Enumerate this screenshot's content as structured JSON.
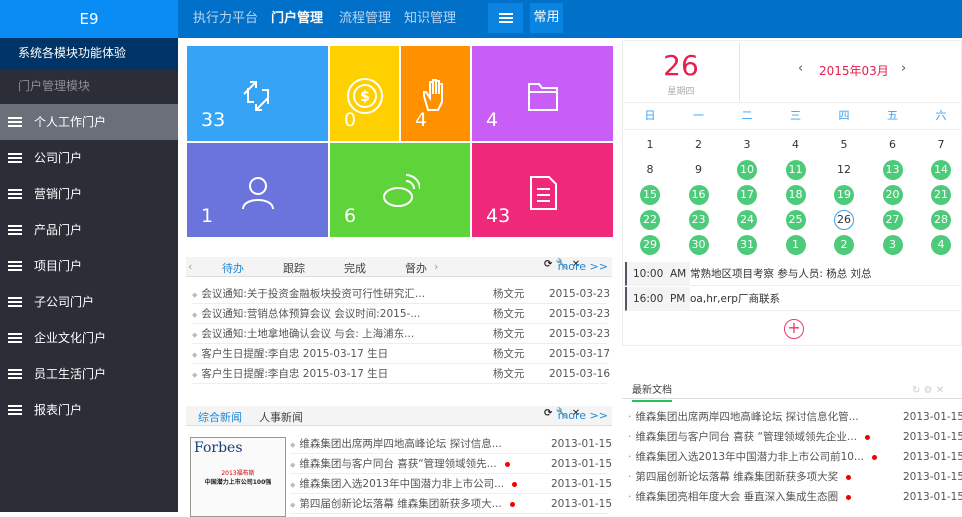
{
  "app": {
    "logo": "E9"
  },
  "topnav": {
    "items": [
      "执行力平台",
      "门户管理",
      "流程管理",
      "知识管理"
    ],
    "active": 1,
    "menu_icon": "hamburger-icon",
    "common_label": "常用"
  },
  "sidebar": {
    "title": "系统各模块功能体验",
    "subtitle": "门户管理模块",
    "items": [
      "个人工作门户",
      "公司门户",
      "营销门户",
      "产品门户",
      "项目门户",
      "子公司门户",
      "企业文化门户",
      "员工生活门户",
      "报表门户"
    ],
    "active": 0
  },
  "tiles": [
    {
      "icon": "sync-arrows-icon",
      "count": "33",
      "color": "#36a3f7"
    },
    {
      "icon": "dollar-coin-icon",
      "count": "0",
      "color": "#ffd000"
    },
    {
      "icon": "hand-icon",
      "count": "4",
      "color": "#ff9000"
    },
    {
      "icon": "folder-icon",
      "count": "4",
      "color": "#c95ef7"
    },
    {
      "icon": "user-icon",
      "count": "1",
      "color": "#6a74dc"
    },
    {
      "icon": "weibo-icon",
      "count": "6",
      "color": "#5ed43a"
    },
    {
      "icon": "document-icon",
      "count": "43",
      "color": "#f0287a"
    }
  ],
  "tasks": {
    "tabs": [
      "待办",
      "跟踪",
      "完成",
      "督办"
    ],
    "active": 0,
    "more": "more >>",
    "rows": [
      {
        "title": "会议通知:关于投资金融板块投资可行性研究汇...",
        "person": "杨文元",
        "date": "2015-03-23"
      },
      {
        "title": "会议通知:营销总体预算会议 会议时间:2015-...",
        "person": "杨文元",
        "date": "2015-03-23"
      },
      {
        "title": "会议通知:土地拿地确认会议 与会: 上海浦东...",
        "person": "杨文元",
        "date": "2015-03-23"
      },
      {
        "title": "客户生日提醒:李自忠 2015-03-17 生日",
        "person": "杨文元",
        "date": "2015-03-17"
      },
      {
        "title": "客户生日提醒:李自忠 2015-03-17 生日",
        "person": "杨文元",
        "date": "2015-03-16"
      }
    ]
  },
  "news": {
    "tabs": [
      "综合新闻",
      "人事新闻"
    ],
    "active": 0,
    "more": "more >>",
    "thumb": {
      "brand": "Forbes",
      "line1": "2013福布斯",
      "line2": "中国潜力上市公司100强"
    },
    "rows": [
      {
        "title": "维森集团出席两岸四地高峰论坛 探讨信息...",
        "date": "2013-01-15",
        "new": false
      },
      {
        "title": "维森集团与客户同台 喜获“管理领域领先...",
        "date": "2013-01-15",
        "new": true
      },
      {
        "title": "维森集团入选2013年中国潜力非上市公司...",
        "date": "2013-01-15",
        "new": true
      },
      {
        "title": "第四届创新论坛落幕 维森集团新获多项大...",
        "date": "2013-01-15",
        "new": true
      }
    ]
  },
  "calendar": {
    "day": "26",
    "weekday": "星期四",
    "month": "2015年03月",
    "weekdays": [
      "日",
      "一",
      "二",
      "三",
      "四",
      "五",
      "六"
    ],
    "days": [
      "1",
      "2",
      "3",
      "4",
      "5",
      "6",
      "7",
      "8",
      "9",
      "10",
      "11",
      "12",
      "13",
      "14",
      "15",
      "16",
      "17",
      "18",
      "19",
      "20",
      "21",
      "22",
      "23",
      "24",
      "25",
      "26",
      "27",
      "28",
      "29",
      "30",
      "31",
      "1",
      "2",
      "3",
      "4"
    ],
    "event_days": [
      9,
      10,
      12,
      13,
      14,
      15,
      16,
      17,
      18,
      19,
      20,
      21,
      22,
      23,
      24,
      26,
      27,
      28,
      29,
      30,
      31,
      32,
      33,
      34
    ],
    "today_index": 25,
    "events": [
      {
        "time": "10:00",
        "ampm": "AM",
        "text": "常熟地区项目考察 参与人员: 杨总 刘总"
      },
      {
        "time": "16:00",
        "ampm": "PM",
        "text": "oa,hr,erp厂商联系"
      }
    ]
  },
  "docs": {
    "tab": "最新文档",
    "rows": [
      {
        "title": "维森集团出席两岸四地高峰论坛 探讨信息化管...",
        "date": "2013-01-15",
        "new": false
      },
      {
        "title": "维森集团与客户同台 喜获 “管理领域领先企业...",
        "date": "2013-01-15",
        "new": true
      },
      {
        "title": "维森集团入选2013年中国潜力非上市公司前10...",
        "date": "2013-01-15",
        "new": true
      },
      {
        "title": "第四届创新论坛落幕 维森集团新获多项大奖",
        "date": "2013-01-15",
        "new": true
      },
      {
        "title": "维森集团亮相年度大会 垂直深入集成生态圈",
        "date": "2013-01-15",
        "new": true
      }
    ]
  }
}
